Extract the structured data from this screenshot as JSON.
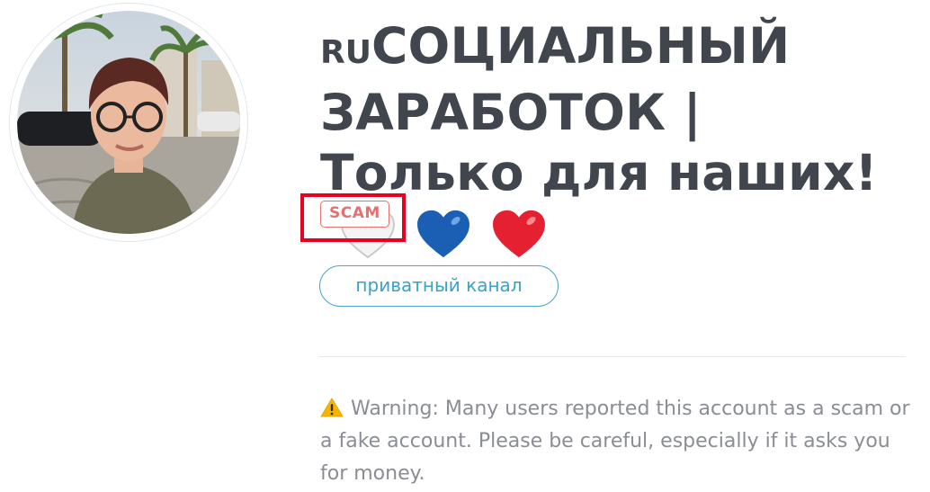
{
  "channel": {
    "title_prefix": "RU",
    "title": "СОЦИАЛЬНЫЙ ЗАРАБОТОК | Только для наших!",
    "hearts": [
      "white-heart-icon",
      "blue-heart-icon",
      "red-heart-icon"
    ],
    "badge": "SCAM",
    "type_label": "приватный канал"
  },
  "warning": {
    "icon": "warning-triangle-icon",
    "text": "Warning: Many users reported this account as a scam or a fake account. Please be careful, especially if it asks you for money."
  },
  "colors": {
    "title": "#41454d",
    "scam": "#e4706f",
    "highlight": "#e8001c",
    "accent": "#3aa2c6",
    "muted": "#8a8d93"
  }
}
